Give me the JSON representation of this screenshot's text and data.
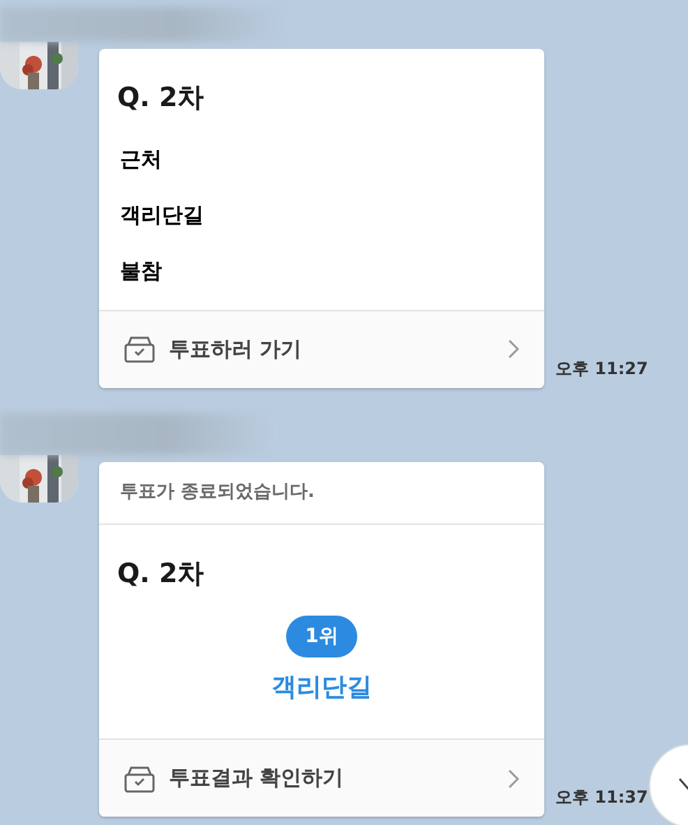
{
  "messages": [
    {
      "kind": "vote",
      "question": "Q. 2차",
      "options": [
        "근처",
        "객리단길",
        "불참"
      ],
      "action": "투표하러 가기",
      "time": "오후 11:27"
    },
    {
      "kind": "result",
      "notice": "투표가 종료되었습니다.",
      "question": "Q. 2차",
      "rank": "1위",
      "winner": "객리단길",
      "action": "투표결과 확인하기",
      "time": "오후 11:37"
    }
  ]
}
